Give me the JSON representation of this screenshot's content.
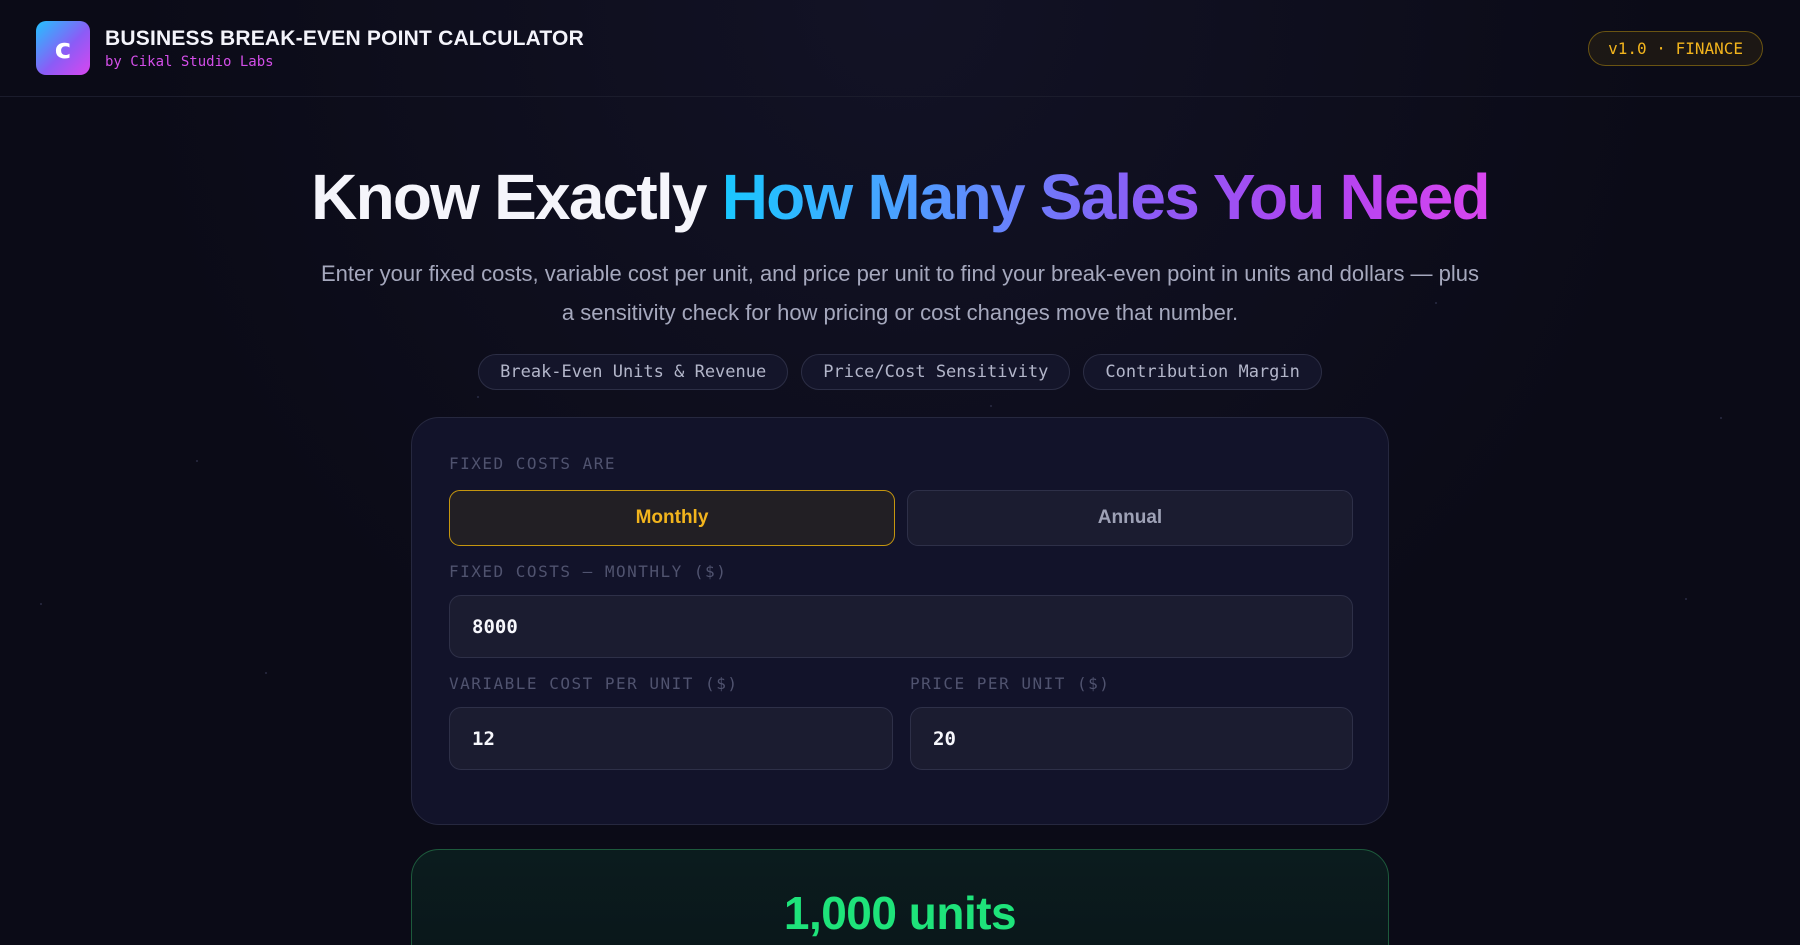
{
  "header": {
    "logo_letter": "c",
    "title": "BUSINESS BREAK-EVEN POINT CALCULATOR",
    "subtitle": "by Cikal Studio Labs",
    "version_badge": "v1.0 · FINANCE"
  },
  "hero": {
    "headline_plain": "Know Exactly ",
    "headline_highlight": "How Many Sales You Need",
    "description": "Enter your fixed costs, variable cost per unit, and price per unit to find your break-even point in units and dollars — plus a sensitivity check for how pricing or cost changes move that number.",
    "chips": [
      "Break-Even Units & Revenue",
      "Price/Cost Sensitivity",
      "Contribution Margin"
    ]
  },
  "form": {
    "fixed_costs_period_label": "FIXED COSTS ARE",
    "period_options": [
      {
        "label": "Monthly",
        "selected": true
      },
      {
        "label": "Annual",
        "selected": false
      }
    ],
    "fixed_costs_label": "FIXED COSTS — MONTHLY ($)",
    "fixed_costs_value": "8000",
    "variable_cost_label": "VARIABLE COST PER UNIT ($)",
    "variable_cost_value": "12",
    "price_label": "PRICE PER UNIT ($)",
    "price_value": "20"
  },
  "result": {
    "value": "1,000 units"
  },
  "colors": {
    "background": "#0b0b17",
    "accent_gold": "#f2b41d",
    "accent_green": "#1ee37a",
    "brand_magenta": "#d34ee8"
  }
}
